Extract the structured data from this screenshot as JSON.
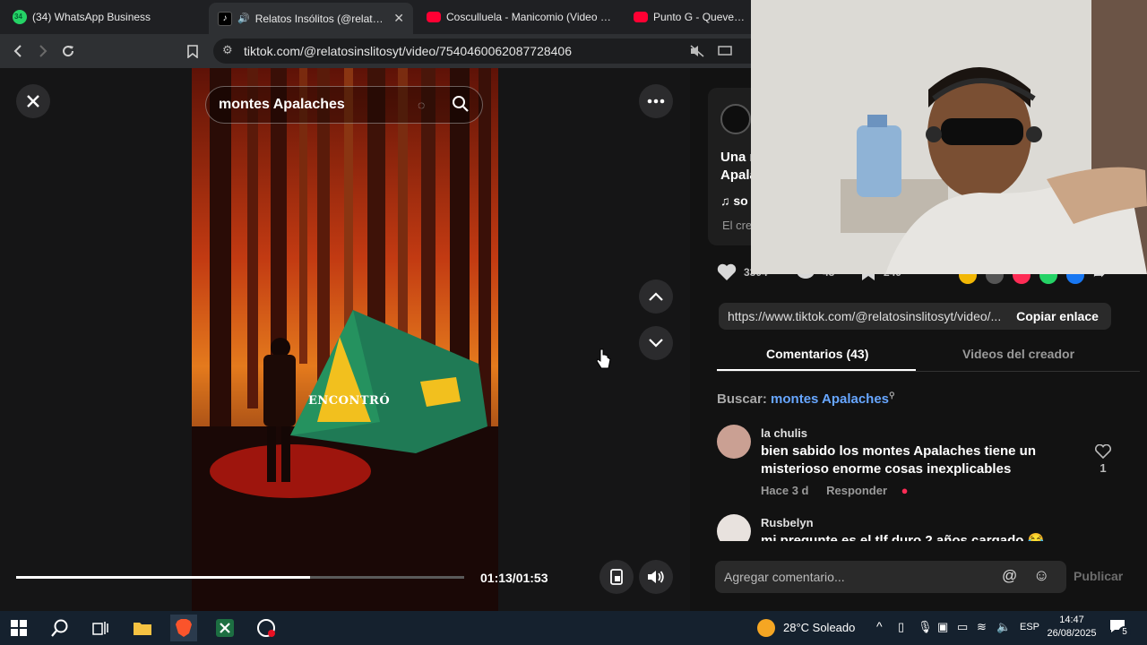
{
  "browser": {
    "tabs": [
      {
        "title": "(34) WhatsApp Business",
        "badge": "34"
      },
      {
        "title": "Relatos Insólitos (@relatosinsl"
      },
      {
        "title": "Cosculluela - Manicomio (Video Ofic"
      },
      {
        "title": "Punto G - Quevedo - V"
      }
    ],
    "url": "tiktok.com/@relatosinslitosyt/video/7540460062087728406"
  },
  "video": {
    "search_text": "montes Apalaches",
    "caption": "ENCONTRÓ",
    "time": "01:13/01:53",
    "progress_fraction": 0.655
  },
  "panel": {
    "info": {
      "title_line1": "Una r",
      "title_line2": "Apala",
      "sound_text": "so",
      "creator_text": "El cre"
    },
    "actions": {
      "likes": "3304",
      "comments": "43",
      "saves": "249"
    },
    "share_link": "https://www.tiktok.com/@relatosinslitosyt/video/...",
    "copy_link_label": "Copiar enlace",
    "tabs": {
      "comments": "Comentarios (43)",
      "creator_videos": "Videos del creador"
    },
    "search_label": "Buscar:",
    "search_term": "montes Apalaches",
    "comments": [
      {
        "user": "la chulis",
        "text": "bien sabido los montes Apalaches tiene un misterioso enorme cosas inexplicables",
        "time": "Hace 3 d",
        "reply": "Responder",
        "likes": "1"
      },
      {
        "user": "Rusbelyn",
        "text": "mi pregunte es el tlf duro 2 años cargado 😂"
      }
    ],
    "add_comment_placeholder": "Agregar comentario...",
    "publish_label": "Publicar"
  },
  "taskbar": {
    "weather": "28°C Soleado",
    "language": "ESP",
    "time": "14:47",
    "date": "26/08/2025",
    "notifications": "5"
  },
  "colors": {
    "accent_link": "#67a6ff",
    "tiktok_red": "#fe2c55",
    "taskbar": "#15212e"
  }
}
